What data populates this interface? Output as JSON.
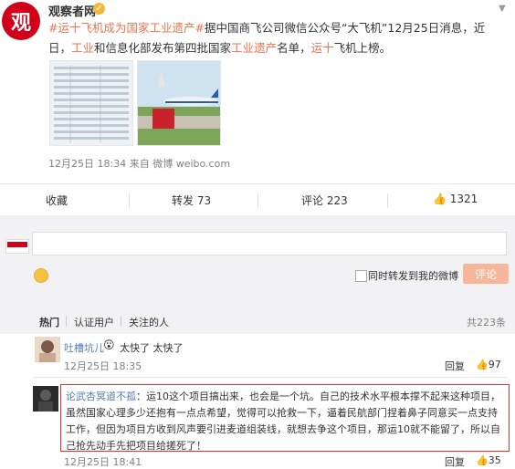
{
  "post": {
    "avatar_char": "观",
    "author": "观察者网",
    "verified_mark": "✓",
    "content_parts": {
      "topic": "#运十飞机成为国家工业遗产#",
      "text1": "据中国商飞公司微信公众号“大飞机”12月25日消息，近日，",
      "hl1": "工业",
      "text2": "和信息化部发布第四批国家",
      "hl2": "工业遗产",
      "text3": "名单，",
      "hl3": "运十",
      "text4": "飞机上榜。"
    },
    "meta": {
      "time": "12月25日 18:34",
      "source_prefix": "来自",
      "source": "微博 weibo.com"
    }
  },
  "actions": {
    "favorite": "收藏",
    "repost": "转发 73",
    "comment": "评论 223",
    "like": "1321"
  },
  "compose": {
    "repost_also": "同时转发到我的微博",
    "submit": "评论"
  },
  "tabs": {
    "hot": "热门",
    "verified": "认证用户",
    "following": "关注的人",
    "total": "共223条"
  },
  "comments": [
    {
      "user": "吐槽坑儿",
      "text": "太快了 太快了",
      "time": "12月25日 18:35",
      "reply": "回复",
      "likes": "97"
    },
    {
      "user": "论武杏冥道不孤",
      "text": "：运10这个项目搞出来，也会是一个坑。自己的技术水平根本撑不起来这种项目，虽然国家心理多少还抱有一点点希望，觉得可以抢救一下，逼着民航部门捏着鼻子同意买一点支持工作，但因为项目方收到风声要引进麦道组装线，就想去争这个项目，那运10就不能留了，所以自己抢先动手先把项目给搓死了！",
      "time": "12月25日 18:41",
      "reply": "回复",
      "likes": "35"
    }
  ],
  "colors": {
    "accent": "#eb7350",
    "link_blue": "#507daf",
    "brand_red": "#d0001b"
  }
}
